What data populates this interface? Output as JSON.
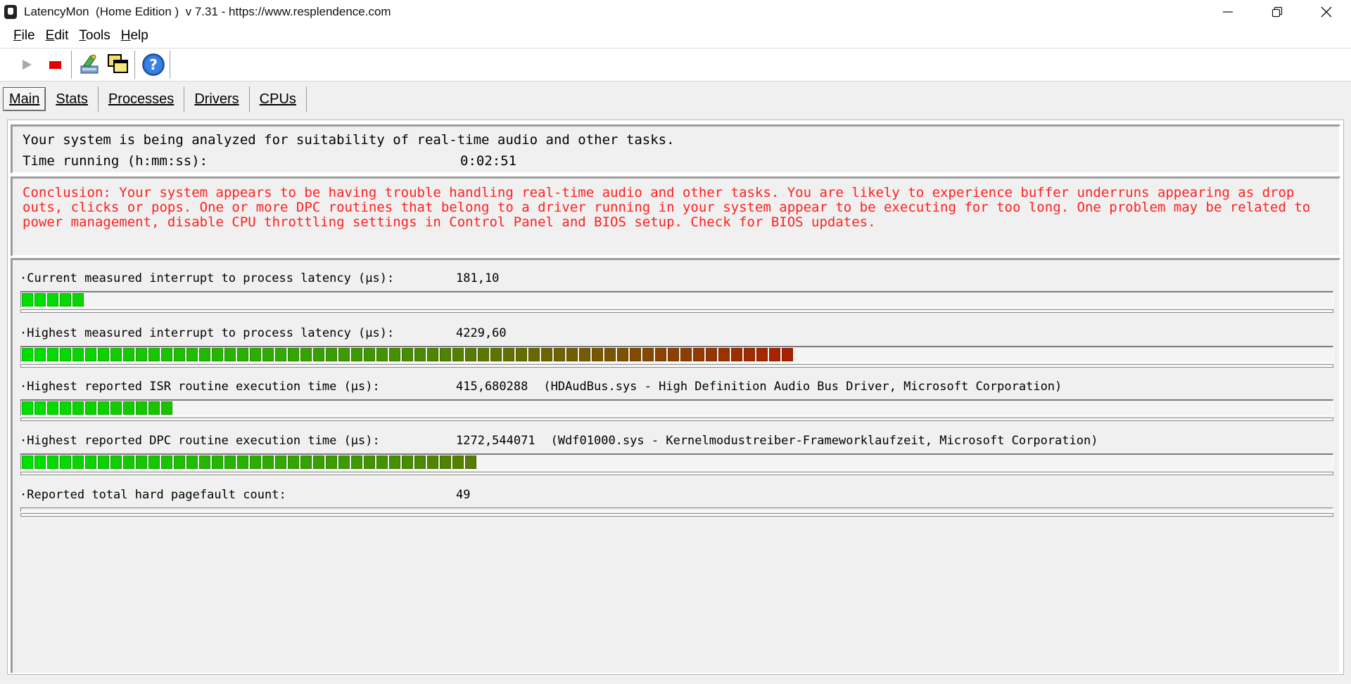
{
  "window": {
    "title": "LatencyMon  (Home Edition )  v 7.31 - https://www.resplendence.com"
  },
  "menu": [
    {
      "underline": "F",
      "rest": "ile"
    },
    {
      "underline": "E",
      "rest": "dit"
    },
    {
      "underline": "T",
      "rest": "ools"
    },
    {
      "underline": "H",
      "rest": "elp"
    }
  ],
  "toolbar": {
    "icons": [
      "play-icon",
      "stop-icon",
      "hardware-wizard-icon",
      "windows-icon",
      "help-icon"
    ]
  },
  "tabs": [
    {
      "label": "Main",
      "active": true
    },
    {
      "label": "Stats",
      "active": false
    },
    {
      "label": "Processes",
      "active": false
    },
    {
      "label": "Drivers",
      "active": false
    },
    {
      "label": "CPUs",
      "active": false
    }
  ],
  "status": {
    "analyzing": "Your system is being analyzed for suitability of real-time audio and other tasks.",
    "time_label": "Time running (h:mm:ss):",
    "time_value": "0:02:51"
  },
  "conclusion": "Conclusion: Your system appears to be having trouble handling real-time audio and other tasks. You are likely to experience buffer underruns appearing as drop outs, clicks or pops. One or more DPC routines that belong to a driver running in your system appear to be executing for too long. One problem may be related to power management, disable CPU throttling settings in Control Panel and BIOS setup. Check for BIOS updates.",
  "metrics": [
    {
      "label": "·Current measured interrupt to process latency (µs):",
      "value": "181,10",
      "extra": "",
      "bar_fraction": 0.05
    },
    {
      "label": "·Highest measured interrupt to process latency (µs):",
      "value": "4229,60",
      "extra": "",
      "bar_fraction": 0.59
    },
    {
      "label": "·Highest reported ISR routine execution time (µs):",
      "value": "415,680288",
      "extra": "(HDAudBus.sys - High Definition Audio Bus Driver, Microsoft Corporation)",
      "bar_fraction": 0.115
    },
    {
      "label": "·Highest reported DPC routine execution time (µs):",
      "value": "1272,544071",
      "extra": "(Wdf01000.sys - Kernelmodustreiber-Frameworklaufzeit, Microsoft Corporation)",
      "bar_fraction": 0.35
    },
    {
      "label": "·Reported total hard pagefault count:",
      "value": "49",
      "extra": "",
      "bar_fraction": null
    }
  ],
  "colors": {
    "bar_low": "#00e000",
    "bar_mid": "#4a8a00",
    "bar_high": "#b01800",
    "conclusion": "#ff2020"
  }
}
